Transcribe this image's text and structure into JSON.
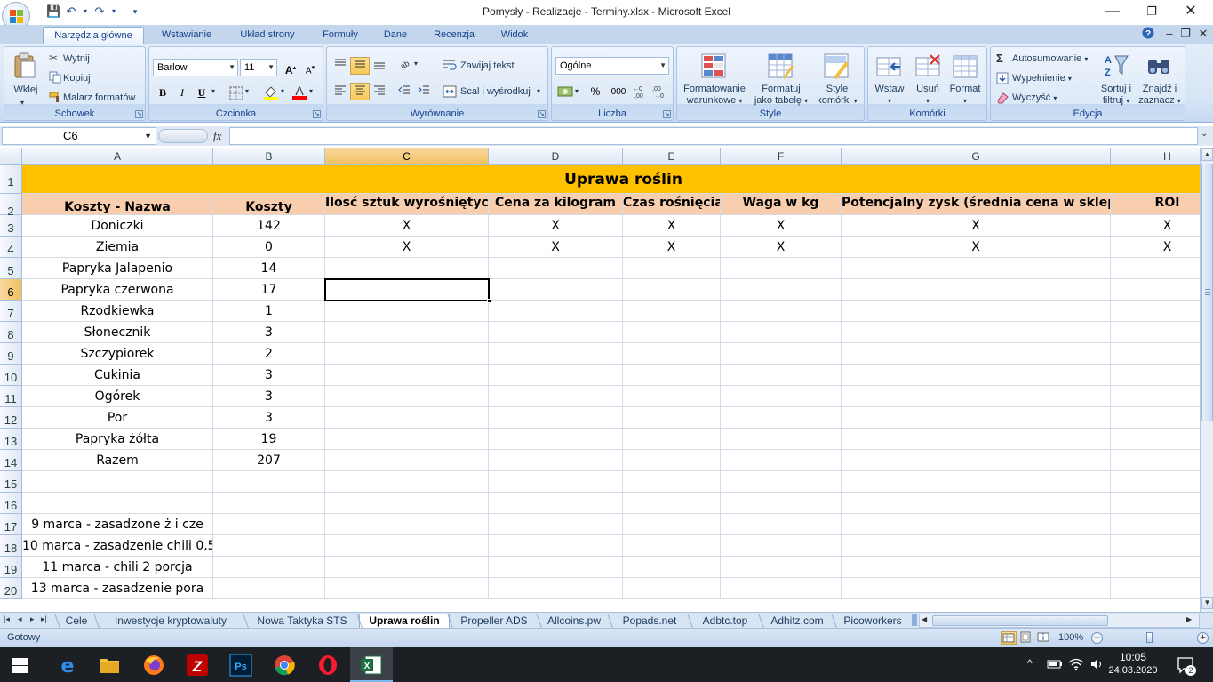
{
  "window": {
    "title": "Pomysły - Realizacje - Terminy.xlsx - Microsoft Excel",
    "minimize": "—",
    "restore": "❐",
    "close": "✕"
  },
  "ribbon_tabs": [
    "Narzędzia główne",
    "Wstawianie",
    "Układ strony",
    "Formuły",
    "Dane",
    "Recenzja",
    "Widok"
  ],
  "ribbon": {
    "clipboard": {
      "label": "Schowek",
      "paste": "Wklej",
      "cut": "Wytnij",
      "copy": "Kopiuj",
      "format_painter": "Malarz formatów"
    },
    "font": {
      "label": "Czcionka",
      "name": "Barlow",
      "size": "11",
      "grow": "A",
      "shrink": "A",
      "bold": "B",
      "italic": "I",
      "underline": "U"
    },
    "alignment": {
      "label": "Wyrównanie",
      "wrap": "Zawijaj tekst",
      "merge": "Scal i wyśrodkuj"
    },
    "number": {
      "label": "Liczba",
      "format": "Ogólne",
      "percent": "%",
      "thousands": "000"
    },
    "styles": {
      "label": "Style",
      "conditional_1": "Formatowanie",
      "conditional_2": "warunkowe",
      "table_1": "Formatuj",
      "table_2": "jako tabelę",
      "cell_1": "Style",
      "cell_2": "komórki"
    },
    "cells": {
      "label": "Komórki",
      "insert": "Wstaw",
      "delete": "Usuń",
      "format": "Format"
    },
    "editing": {
      "label": "Edycja",
      "autosum": "Autosumowanie",
      "fill": "Wypełnienie",
      "clear": "Wyczyść",
      "sort_1": "Sortuj i",
      "sort_2": "filtruj",
      "find_1": "Znajdź i",
      "find_2": "zaznacz"
    }
  },
  "formula_bar": {
    "name_box": "C6",
    "fx": "fx",
    "formula": ""
  },
  "columns": [
    "A",
    "B",
    "C",
    "D",
    "E",
    "F",
    "G",
    "H"
  ],
  "selected_column": "C",
  "selected_row": "6",
  "sheet": {
    "title": "Uprawa roślin",
    "headers": [
      "Koszty - Nazwa",
      "Koszty",
      "Ilosć sztuk wyrośniętych",
      "Cena za kilogram",
      "Czas rośnięcia",
      "Waga w kg",
      "Potencjalny zysk (średnia cena w sklepie)",
      "ROI"
    ],
    "rows": [
      [
        "Doniczki",
        "142",
        "X",
        "X",
        "X",
        "X",
        "X",
        "X"
      ],
      [
        "Ziemia",
        "0",
        "X",
        "X",
        "X",
        "X",
        "X",
        "X"
      ],
      [
        "Papryka Jalapenio",
        "14",
        "",
        "",
        "",
        "",
        "",
        ""
      ],
      [
        "Papryka czerwona",
        "17",
        "",
        "",
        "",
        "",
        "",
        ""
      ],
      [
        "Rzodkiewka",
        "1",
        "",
        "",
        "",
        "",
        "",
        ""
      ],
      [
        "Słonecznik",
        "3",
        "",
        "",
        "",
        "",
        "",
        ""
      ],
      [
        "Szczypiorek",
        "2",
        "",
        "",
        "",
        "",
        "",
        ""
      ],
      [
        "Cukinia",
        "3",
        "",
        "",
        "",
        "",
        "",
        ""
      ],
      [
        "Ogórek",
        "3",
        "",
        "",
        "",
        "",
        "",
        ""
      ],
      [
        "Por",
        "3",
        "",
        "",
        "",
        "",
        "",
        ""
      ],
      [
        "Papryka żółta",
        "19",
        "",
        "",
        "",
        "",
        "",
        ""
      ],
      [
        "Razem",
        "207",
        "",
        "",
        "",
        "",
        "",
        ""
      ],
      [
        "",
        "",
        "",
        "",
        "",
        "",
        "",
        ""
      ],
      [
        "",
        "",
        "",
        "",
        "",
        "",
        "",
        ""
      ],
      [
        "9 marca - zasadzone ż i cze",
        "",
        "",
        "",
        "",
        "",
        "",
        ""
      ],
      [
        "10 marca - zasadzenie chili 0,5",
        "",
        "",
        "",
        "",
        "",
        "",
        ""
      ],
      [
        "11 marca - chili 2 porcja",
        "",
        "",
        "",
        "",
        "",
        "",
        ""
      ],
      [
        "13 marca - zasadzenie pora",
        "",
        "",
        "",
        "",
        "",
        "",
        ""
      ]
    ],
    "row_numbers": [
      "1",
      "2",
      "3",
      "4",
      "5",
      "6",
      "7",
      "8",
      "9",
      "10",
      "11",
      "12",
      "13",
      "14",
      "15",
      "16",
      "17",
      "18",
      "19",
      "20"
    ]
  },
  "sheet_tabs": [
    "Cele",
    "Inwestycje kryptowaluty",
    "Nowa Taktyka STS",
    "Uprawa roślin",
    "Propeller ADS",
    "Allcoins.pw",
    "Popads.net",
    "Adbtc.top",
    "Adhitz.com",
    "Picoworkers"
  ],
  "active_sheet": "Uprawa roślin",
  "status": {
    "ready": "Gotowy",
    "zoom": "100%"
  },
  "taskbar": {
    "time": "10:05",
    "date": "24.03.2020",
    "notifications": "2"
  },
  "colors": {
    "title_fill": "#ffc000",
    "header_fill": "#f8ceae",
    "accent": "#15428b"
  }
}
